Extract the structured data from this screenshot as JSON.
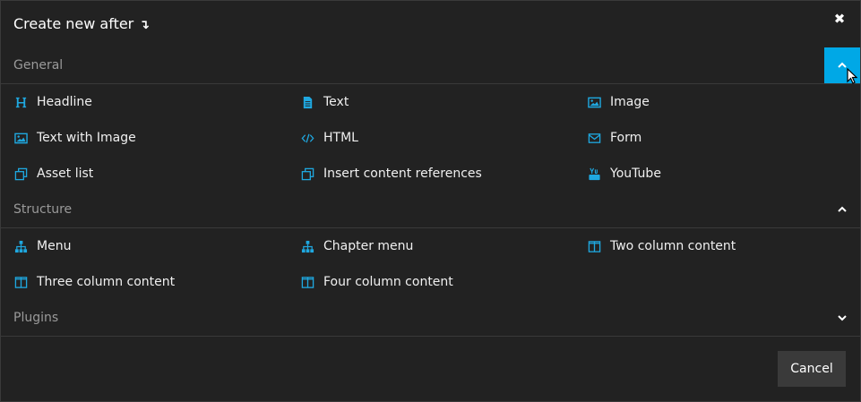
{
  "dialog": {
    "title": "Create new after",
    "title_arrow": "↴",
    "close_glyph": "✖",
    "cancel_label": "Cancel"
  },
  "accent_color": "#00a8e6",
  "sections": {
    "general": {
      "label": "General",
      "expanded": true,
      "items": [
        {
          "label": "Headline",
          "icon": "heading-icon"
        },
        {
          "label": "Text",
          "icon": "document-icon"
        },
        {
          "label": "Image",
          "icon": "image-icon"
        },
        {
          "label": "Text with Image",
          "icon": "image-icon"
        },
        {
          "label": "HTML",
          "icon": "code-icon"
        },
        {
          "label": "Form",
          "icon": "envelope-icon"
        },
        {
          "label": "Asset list",
          "icon": "copy-icon"
        },
        {
          "label": "Insert content references",
          "icon": "copy-icon"
        },
        {
          "label": "YouTube",
          "icon": "youtube-icon"
        }
      ]
    },
    "structure": {
      "label": "Structure",
      "expanded": true,
      "items": [
        {
          "label": "Menu",
          "icon": "sitemap-icon"
        },
        {
          "label": "Chapter menu",
          "icon": "sitemap-icon"
        },
        {
          "label": "Two column content",
          "icon": "columns-icon"
        },
        {
          "label": "Three column content",
          "icon": "columns-icon"
        },
        {
          "label": "Four column content",
          "icon": "columns-icon"
        }
      ]
    },
    "plugins": {
      "label": "Plugins",
      "expanded": false
    }
  }
}
